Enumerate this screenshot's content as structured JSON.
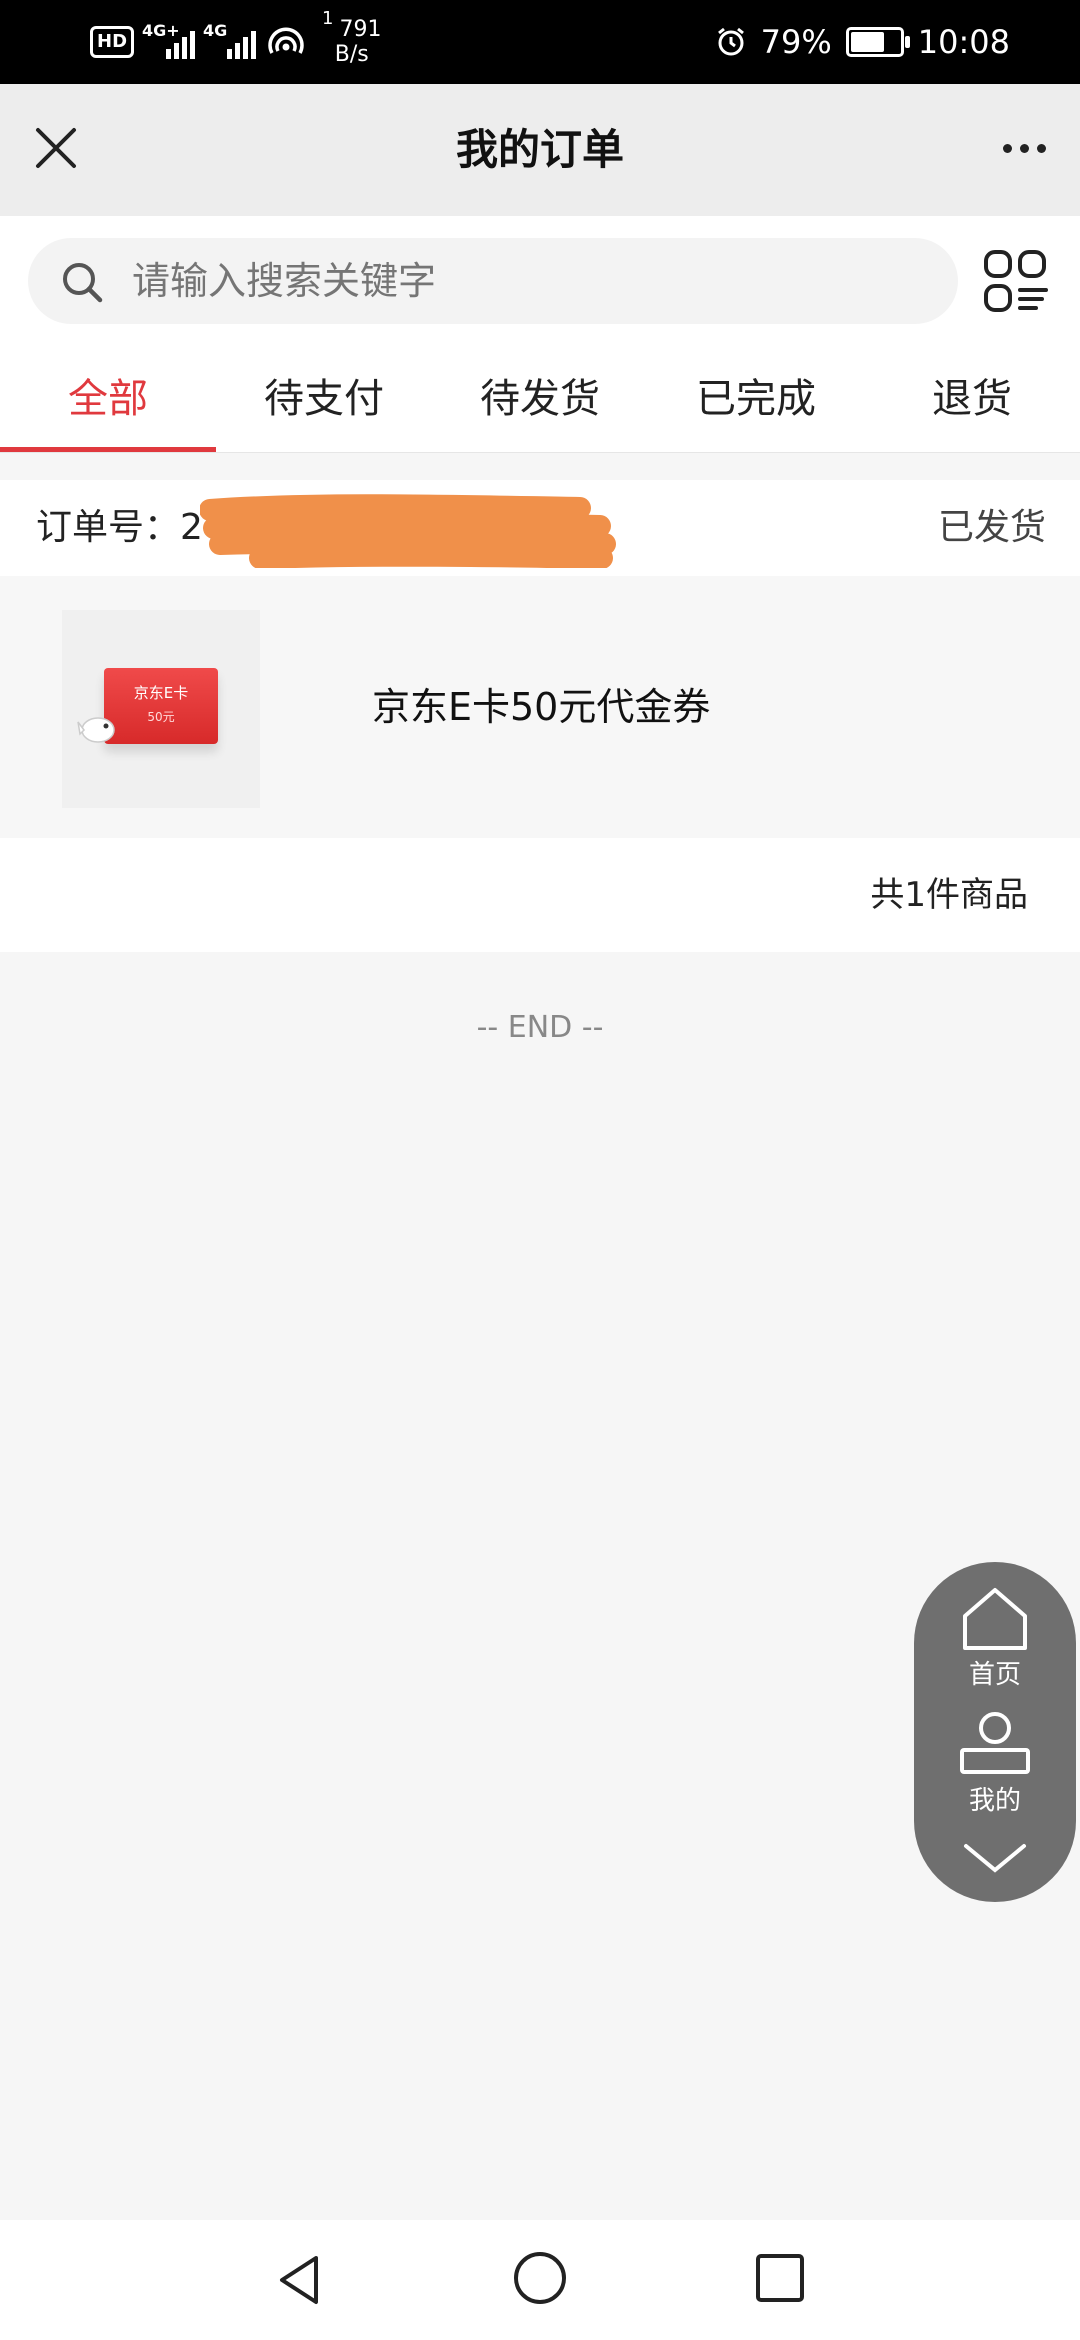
{
  "status_bar": {
    "signal1_label": "4G+",
    "signal2_label": "4G",
    "net_speed_prefix": "1",
    "net_speed_value": "791",
    "net_speed_unit": "B/s",
    "battery_percent": "79%",
    "battery_level": 0.79,
    "time": "10:08"
  },
  "header": {
    "title": "我的订单"
  },
  "search": {
    "placeholder": "请输入搜索关键字"
  },
  "tabs": [
    {
      "label": "全部",
      "active": true
    },
    {
      "label": "待支付",
      "active": false
    },
    {
      "label": "待发货",
      "active": false
    },
    {
      "label": "已完成",
      "active": false
    },
    {
      "label": "退货",
      "active": false
    }
  ],
  "order": {
    "number_label": "订单号：2",
    "status": "已发货",
    "product": {
      "name": "京东E卡50元代金券",
      "card_title": "京东E卡",
      "card_amount": "50元"
    },
    "count_text": "共1件商品"
  },
  "end_text": "-- END --",
  "float_nav": {
    "home_label": "首页",
    "mine_label": "我的"
  },
  "colors": {
    "accent": "#e0393e",
    "redaction": "#f0904a",
    "float_nav_bg": "#6f6f6f"
  }
}
